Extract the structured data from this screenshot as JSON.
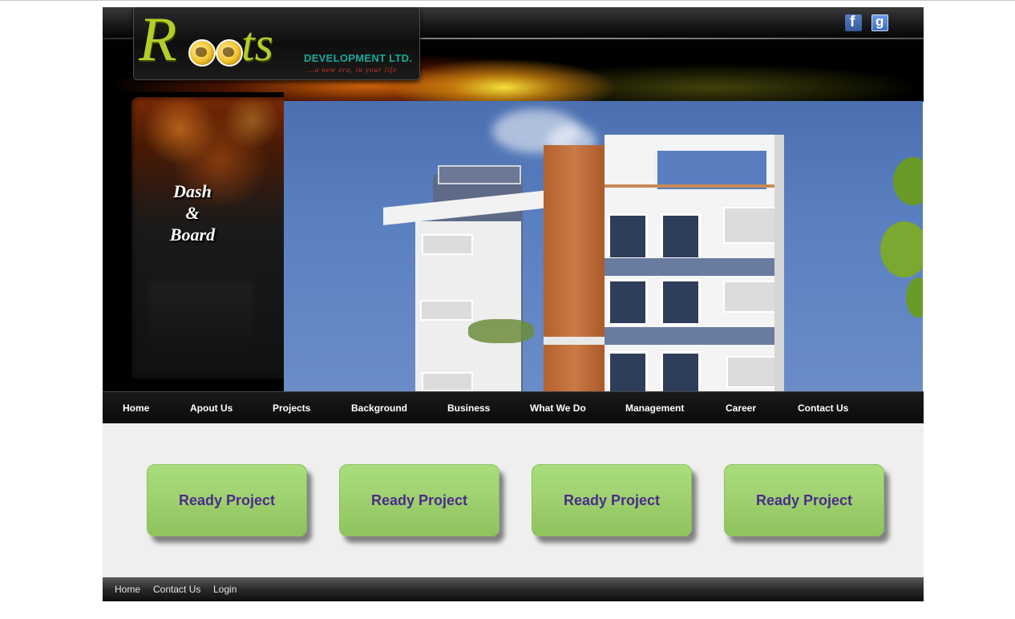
{
  "brand": {
    "logo_wordmark": "Roots",
    "company_suffix": "DEVELOPMENT LTD.",
    "tagline": "...a new era, in your life"
  },
  "social": {
    "icons": [
      "facebook-icon",
      "google-icon"
    ]
  },
  "banner": {
    "side_title_lines": [
      "Dash",
      "&",
      "Board"
    ]
  },
  "nav": {
    "items": [
      "Home",
      "Apout Us",
      "Projects",
      "Background",
      "Business",
      "What We Do",
      "Management",
      "Career",
      "Contact Us"
    ]
  },
  "projects": {
    "buttons": [
      "Ready Project",
      "Ready Project",
      "Ready Project",
      "Ready Project"
    ]
  },
  "footer": {
    "links": [
      "Home",
      "Contact Us",
      "Login"
    ]
  },
  "colors": {
    "nav_bg": "#0a0a0a",
    "button_green": "#9ed06e",
    "button_text": "#4b2c8a",
    "logo_green": "#b6cc2a",
    "sky_blue": "#5a7fc0"
  }
}
